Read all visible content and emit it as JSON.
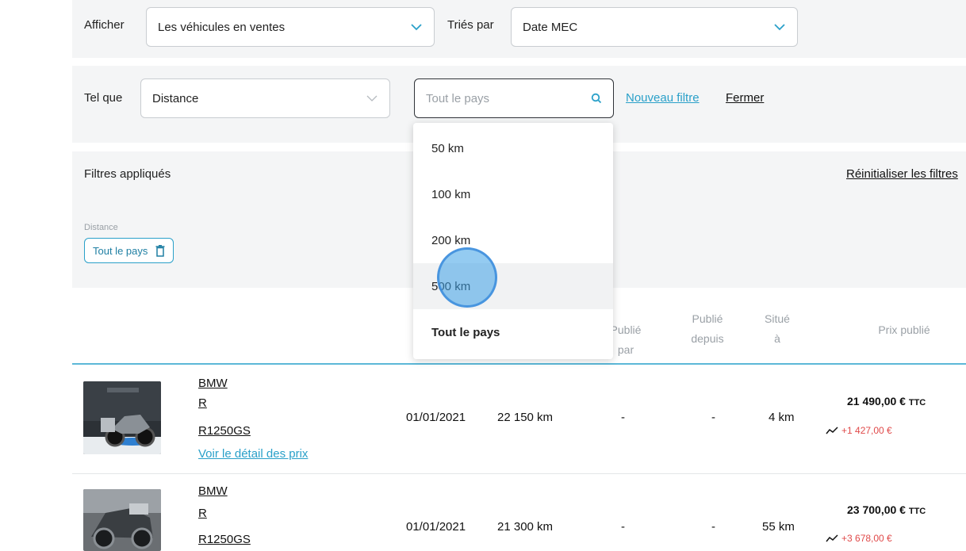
{
  "filters": {
    "show_label": "Afficher",
    "show_value": "Les véhicules en ventes",
    "sort_label": "Triés par",
    "sort_value": "Date MEC",
    "such_as_label": "Tel que",
    "criterion_value": "Distance",
    "search_placeholder": "Tout le pays",
    "new_filter_link": "Nouveau filtre",
    "close_link": "Fermer"
  },
  "applied": {
    "title": "Filtres appliqués",
    "reset_link": "Réinitialiser les filtres",
    "chip_group_label": "Distance",
    "chip_value": "Tout le pays"
  },
  "dropdown": {
    "options": [
      "50 km",
      "100 km",
      "200 km",
      "500 km",
      "Tout le pays"
    ],
    "hovered_index": 3,
    "selected_index": 4
  },
  "table": {
    "headers": {
      "published_by": "Publié par",
      "published_since_1": "Publié",
      "published_since_2": "depuis",
      "located_1": "Situé",
      "located_2": "à",
      "price": "Prix publié"
    },
    "rows": [
      {
        "brand": "BMW",
        "model": "R",
        "version": "R1250GS",
        "detail_link": "Voir le détail des prix",
        "date": "01/01/2021",
        "km": "22 150 km",
        "published_by": "-",
        "published_since": "-",
        "distance": "4 km",
        "price": "21 490,00 €",
        "price_suffix": "TTC",
        "delta": "+1 427,00 €"
      },
      {
        "brand": "BMW",
        "model": "R",
        "version": "R1250GS",
        "date": "01/01/2021",
        "km": "21 300 km",
        "published_by": "-",
        "published_since": "-",
        "distance": "55 km",
        "price": "23 700,00 €",
        "price_suffix": "TTC",
        "delta": "+3 678,00 €"
      }
    ]
  },
  "colors": {
    "accent": "#2aa0c9",
    "panel_bg": "#f4f5f6",
    "negative": "#e04a4a",
    "cursor": "#3ca0e6"
  },
  "icons": [
    "chevron-down-icon",
    "search-icon",
    "trash-icon",
    "trend-up-icon"
  ]
}
